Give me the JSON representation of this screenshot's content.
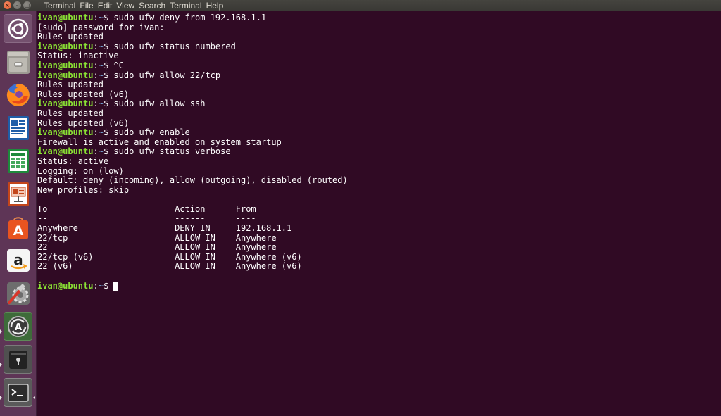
{
  "topbar": {
    "window_buttons": {
      "close": "×",
      "minimize": "–",
      "maximize": "□"
    },
    "menu": [
      "Terminal",
      "File",
      "Edit",
      "View",
      "Search",
      "Terminal",
      "Help"
    ]
  },
  "launcher": {
    "items": [
      {
        "name": "ubuntu-dash-icon",
        "running": false
      },
      {
        "name": "files-icon",
        "running": false
      },
      {
        "name": "firefox-icon",
        "running": false
      },
      {
        "name": "libreoffice-writer-icon",
        "running": false
      },
      {
        "name": "libreoffice-calc-icon",
        "running": false
      },
      {
        "name": "libreoffice-impress-icon",
        "running": false
      },
      {
        "name": "ubuntu-software-icon",
        "running": false
      },
      {
        "name": "amazon-icon",
        "running": false
      },
      {
        "name": "system-settings-icon",
        "running": false
      },
      {
        "name": "software-updater-icon",
        "running": true
      },
      {
        "name": "password-keys-icon",
        "running": true
      },
      {
        "name": "terminal-icon",
        "running": true,
        "focused": true
      }
    ]
  },
  "terminal": {
    "prompt": {
      "user_host": "ivan@ubuntu",
      "path": "~",
      "symbol": "$ "
    },
    "lines": [
      {
        "type": "cmd",
        "text": "sudo ufw deny from 192.168.1.1"
      },
      {
        "type": "out",
        "text": "[sudo] password for ivan:"
      },
      {
        "type": "out",
        "text": "Rules updated"
      },
      {
        "type": "cmd",
        "text": "sudo ufw status numbered"
      },
      {
        "type": "out",
        "text": "Status: inactive"
      },
      {
        "type": "cmd",
        "text": "^C"
      },
      {
        "type": "cmd",
        "text": "sudo ufw allow 22/tcp"
      },
      {
        "type": "out",
        "text": "Rules updated"
      },
      {
        "type": "out",
        "text": "Rules updated (v6)"
      },
      {
        "type": "cmd",
        "text": "sudo ufw allow ssh"
      },
      {
        "type": "out",
        "text": "Rules updated"
      },
      {
        "type": "out",
        "text": "Rules updated (v6)"
      },
      {
        "type": "cmd",
        "text": "sudo ufw enable"
      },
      {
        "type": "out",
        "text": "Firewall is active and enabled on system startup"
      },
      {
        "type": "cmd",
        "text": "sudo ufw status verbose"
      },
      {
        "type": "out",
        "text": "Status: active"
      },
      {
        "type": "out",
        "text": "Logging: on (low)"
      },
      {
        "type": "out",
        "text": "Default: deny (incoming), allow (outgoing), disabled (routed)"
      },
      {
        "type": "out",
        "text": "New profiles: skip"
      },
      {
        "type": "out",
        "text": ""
      },
      {
        "type": "out",
        "text": "To                         Action      From"
      },
      {
        "type": "out",
        "text": "--                         ------      ----"
      },
      {
        "type": "out",
        "text": "Anywhere                   DENY IN     192.168.1.1"
      },
      {
        "type": "out",
        "text": "22/tcp                     ALLOW IN    Anywhere"
      },
      {
        "type": "out",
        "text": "22                         ALLOW IN    Anywhere"
      },
      {
        "type": "out",
        "text": "22/tcp (v6)                ALLOW IN    Anywhere (v6)"
      },
      {
        "type": "out",
        "text": "22 (v6)                    ALLOW IN    Anywhere (v6)"
      },
      {
        "type": "out",
        "text": ""
      },
      {
        "type": "prompt",
        "text": ""
      }
    ]
  },
  "colors": {
    "terminal_bg": "#300a24",
    "prompt_user": "#8ae234",
    "prompt_path": "#729fcf",
    "launcher_bg": "#5e3556",
    "topbar_bg": "#3c3b37"
  }
}
